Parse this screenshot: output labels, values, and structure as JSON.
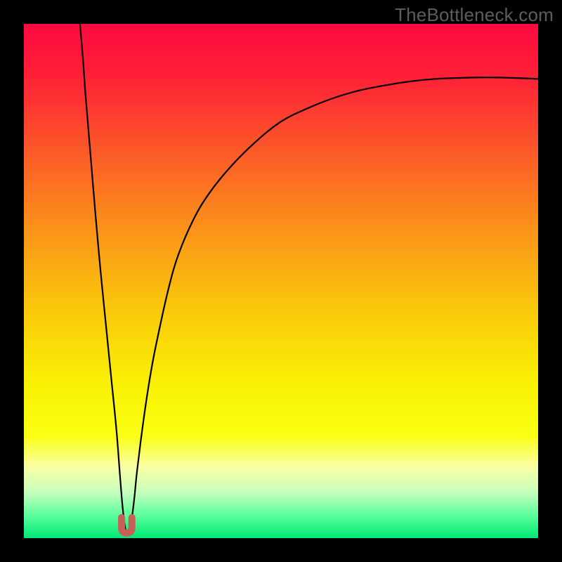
{
  "watermark": "TheBottleneck.com",
  "chart_data": {
    "type": "line",
    "title": "",
    "xlabel": "",
    "ylabel": "",
    "xlim": [
      0,
      100
    ],
    "ylim": [
      0,
      100
    ],
    "series": [
      {
        "name": "bottleneck-curve",
        "x": [
          10.9,
          11.5,
          12.0,
          13.0,
          14.0,
          15.0,
          16.0,
          17.0,
          18.0,
          18.7,
          19.2,
          19.7,
          20.0,
          20.5,
          21.0,
          21.5,
          22.0,
          23.0,
          24.0,
          25.0,
          26.0,
          28.0,
          30.0,
          33.0,
          36.0,
          40.0,
          45.0,
          50.0,
          55.0,
          60.0,
          65.0,
          70.0,
          75.0,
          80.0,
          85.0,
          90.0,
          95.0,
          100.0
        ],
        "y": [
          100.0,
          93.0,
          86.0,
          74.0,
          62.0,
          51.0,
          41.0,
          31.0,
          21.0,
          12.0,
          6.0,
          2.0,
          1.0,
          2.0,
          4.0,
          8.0,
          13.0,
          21.0,
          28.0,
          34.0,
          39.0,
          48.0,
          55.0,
          62.0,
          67.0,
          72.0,
          77.0,
          81.0,
          83.5,
          85.5,
          87.0,
          88.0,
          88.8,
          89.3,
          89.5,
          89.6,
          89.5,
          89.3
        ]
      }
    ],
    "marker": {
      "name": "current-position",
      "shape": "U",
      "color": "#c86058",
      "x_range": [
        19.0,
        21.0
      ],
      "y_range": [
        1.0,
        4.0
      ]
    },
    "gradient_stops": [
      {
        "pos": 0.0,
        "color": "#fe093e"
      },
      {
        "pos": 0.1,
        "color": "#fe2037"
      },
      {
        "pos": 0.25,
        "color": "#fc5a28"
      },
      {
        "pos": 0.4,
        "color": "#fb9319"
      },
      {
        "pos": 0.55,
        "color": "#fac70b"
      },
      {
        "pos": 0.7,
        "color": "#f9f104"
      },
      {
        "pos": 0.8,
        "color": "#faff13"
      },
      {
        "pos": 0.86,
        "color": "#fbffa2"
      },
      {
        "pos": 0.91,
        "color": "#c8ffbe"
      },
      {
        "pos": 0.955,
        "color": "#5dff9d"
      },
      {
        "pos": 1.0,
        "color": "#00e875"
      }
    ]
  }
}
